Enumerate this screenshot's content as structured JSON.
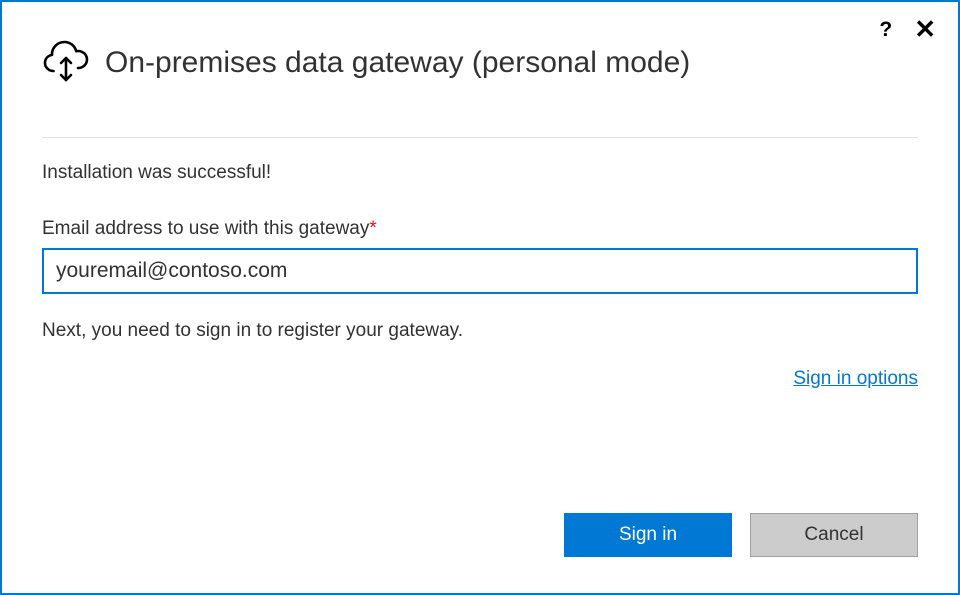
{
  "header": {
    "title": "On-premises data gateway (personal mode)"
  },
  "titlebarControls": {
    "help": "?",
    "close": "✕"
  },
  "body": {
    "successMessage": "Installation was successful!",
    "emailLabel": "Email address to use with this gateway",
    "requiredMark": "*",
    "emailValue": "youremail@contoso.com",
    "nextMessage": "Next, you need to sign in to register your gateway.",
    "signInOptions": "Sign in options"
  },
  "footer": {
    "signIn": "Sign in",
    "cancel": "Cancel"
  }
}
